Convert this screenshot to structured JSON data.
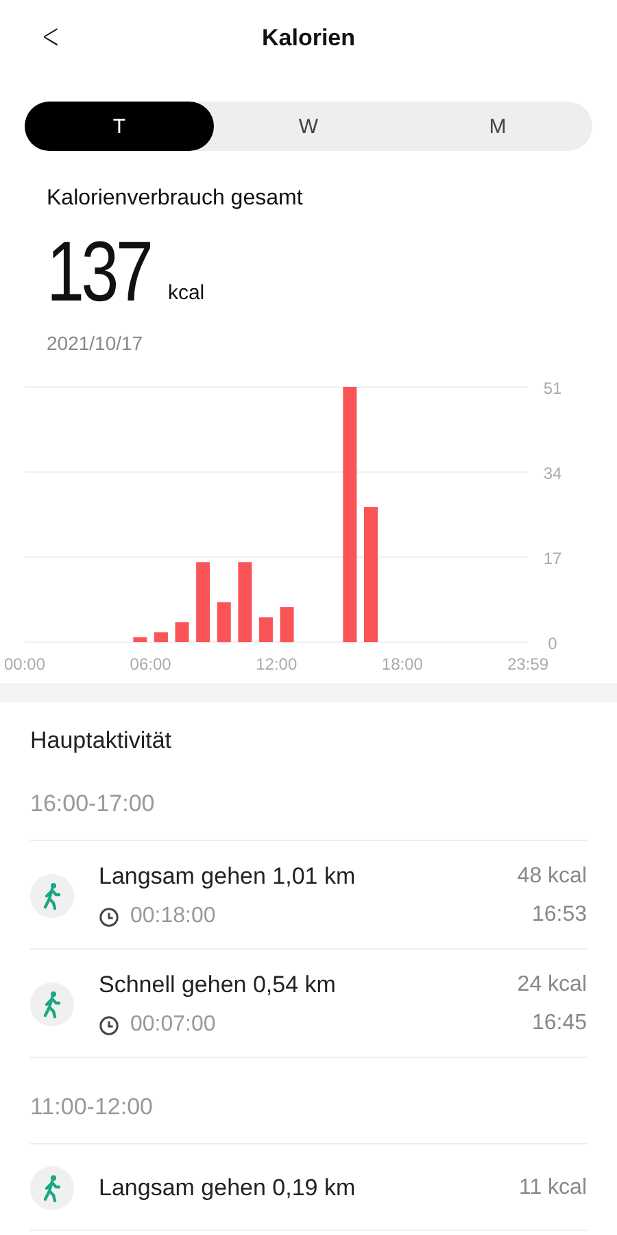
{
  "header": {
    "back": "<",
    "title": "Kalorien"
  },
  "tabs": [
    {
      "label": "T",
      "selected": true
    },
    {
      "label": "W",
      "selected": false
    },
    {
      "label": "M",
      "selected": false
    }
  ],
  "summary": {
    "title": "Kalorienverbrauch gesamt",
    "value": "137",
    "unit": "kcal",
    "date": "2021/10/17"
  },
  "chart_data": {
    "type": "bar",
    "x": [
      0.5,
      1.5,
      2.5,
      3.5,
      4.5,
      5.5,
      6.5,
      7.5,
      8.5,
      9.5,
      10.5,
      11.5,
      12.5,
      13.5,
      14.5,
      15.5,
      16.5,
      17.5,
      18.5,
      19.5,
      20.5,
      21.5,
      22.5,
      23.5
    ],
    "series": [
      {
        "color": "#fa5456",
        "values": [
          0,
          0,
          0,
          0,
          0,
          1,
          2,
          4,
          16,
          8,
          16,
          5,
          7,
          0,
          0,
          51,
          27,
          0,
          0,
          0,
          0,
          0,
          0,
          0
        ]
      }
    ],
    "xlim": [
      0,
      23.983
    ],
    "ylim": [
      0,
      51
    ],
    "xticks": [
      {
        "value": 0,
        "label": "00:00"
      },
      {
        "value": 6,
        "label": "06:00"
      },
      {
        "value": 12,
        "label": "12:00"
      },
      {
        "value": 18,
        "label": "18:00"
      },
      {
        "value": 23.983,
        "label": "23:59"
      }
    ],
    "yticks": [
      0,
      17,
      34,
      51
    ]
  },
  "activities": {
    "title": "Hauptaktivität",
    "groups": [
      {
        "period": "16:00-17:00",
        "items": [
          {
            "name": "Langsam gehen 1,01 km",
            "duration": "00:18:00",
            "kcal": "48 kcal",
            "time": "16:53"
          },
          {
            "name": "Schnell gehen 0,54 km",
            "duration": "00:07:00",
            "kcal": "24 kcal",
            "time": "16:45"
          }
        ]
      },
      {
        "period": "11:00-12:00",
        "items": [
          {
            "name": "Langsam gehen 0,19 km",
            "kcal": "11 kcal"
          }
        ]
      }
    ]
  }
}
